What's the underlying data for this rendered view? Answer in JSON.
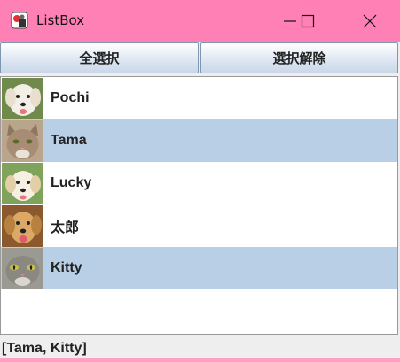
{
  "window": {
    "title": "ListBox",
    "titlebar_color": "#ff80b4",
    "controls": [
      "minimize-icon",
      "maximize-icon",
      "close-icon"
    ]
  },
  "toolbar": {
    "select_all_label": "全選択",
    "deselect_all_label": "選択解除"
  },
  "list": {
    "selection_color": "#b8cfe5",
    "items": [
      {
        "label": "Pochi",
        "icon": "dog-photo-icon",
        "selected": false
      },
      {
        "label": "Tama",
        "icon": "cat-photo-icon",
        "selected": true
      },
      {
        "label": "Lucky",
        "icon": "dog-photo-icon",
        "selected": false
      },
      {
        "label": "太郎",
        "icon": "dog-photo-icon",
        "selected": false
      },
      {
        "label": "Kitty",
        "icon": "cat-photo-icon",
        "selected": true
      }
    ]
  },
  "status": {
    "text": "[Tama, Kitty]"
  }
}
